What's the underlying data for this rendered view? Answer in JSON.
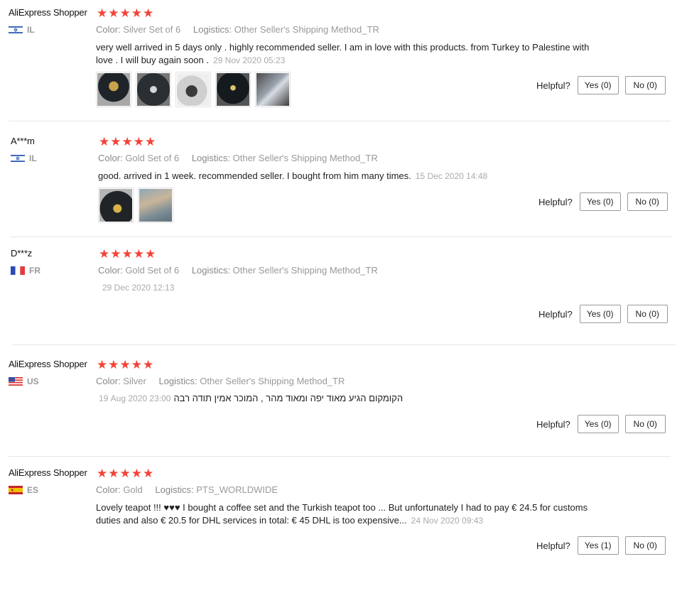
{
  "labels": {
    "helpful": "Helpful?",
    "color": "Color:",
    "logistics": "Logistics:"
  },
  "reviews": [
    {
      "user": "AliExpress Shopper",
      "country": "IL",
      "flag": "israel-flag",
      "color": "Silver Set of 6",
      "logistics": "Other Seller's Shipping Method_TR",
      "text": "very well arrived in 5 days only . highly recommended seller. I am in love with this products. from Turkey to Palestine with love . I will buy again soon .",
      "date": "29 Nov 2020 05:23",
      "yes": "Yes (0)",
      "no": "No (0)"
    },
    {
      "user": "A***m",
      "country": "IL",
      "flag": "israel-flag",
      "color": "Gold Set of 6",
      "logistics": "Other Seller's Shipping Method_TR",
      "text": "good. arrived in 1 week. recommended seller. I bought from him many times.",
      "date": "15 Dec 2020 14:48",
      "yes": "Yes (0)",
      "no": "No (0)"
    },
    {
      "user": "D***z",
      "country": "FR",
      "flag": "france-flag",
      "color": "Gold Set of 6",
      "logistics": "Other Seller's Shipping Method_TR",
      "text": "",
      "date": "29 Dec 2020 12:13",
      "yes": "Yes (0)",
      "no": "No (0)"
    },
    {
      "user": "AliExpress Shopper",
      "country": "US",
      "flag": "usa-flag",
      "color": "Silver",
      "logistics": "Other Seller's Shipping Method_TR",
      "text": "הקומקום הגיע מאוד יפה ומאוד מהר , המוכר אמין תודה רבה",
      "date": "19 Aug 2020 23:00",
      "yes": "Yes (0)",
      "no": "No (0)"
    },
    {
      "user": "AliExpress Shopper",
      "country": "ES",
      "flag": "spain-flag",
      "color": "Gold",
      "logistics": "PTS_WORLDWIDE",
      "text": "Lovely teapot !!! ♥♥♥ I bought a coffee set and the Turkish teapot too ... But unfortunately I had to pay € 24.5 for customs duties and also € 20.5 for DHL services in total: € 45 DHL is too expensive...",
      "date": "24 Nov 2020 09:43",
      "yes": "Yes (1)",
      "no": "No (0)"
    }
  ],
  "rating_stars": 5,
  "colors": {
    "star": "#f44336",
    "muted": "#999999",
    "text": "#222222"
  }
}
